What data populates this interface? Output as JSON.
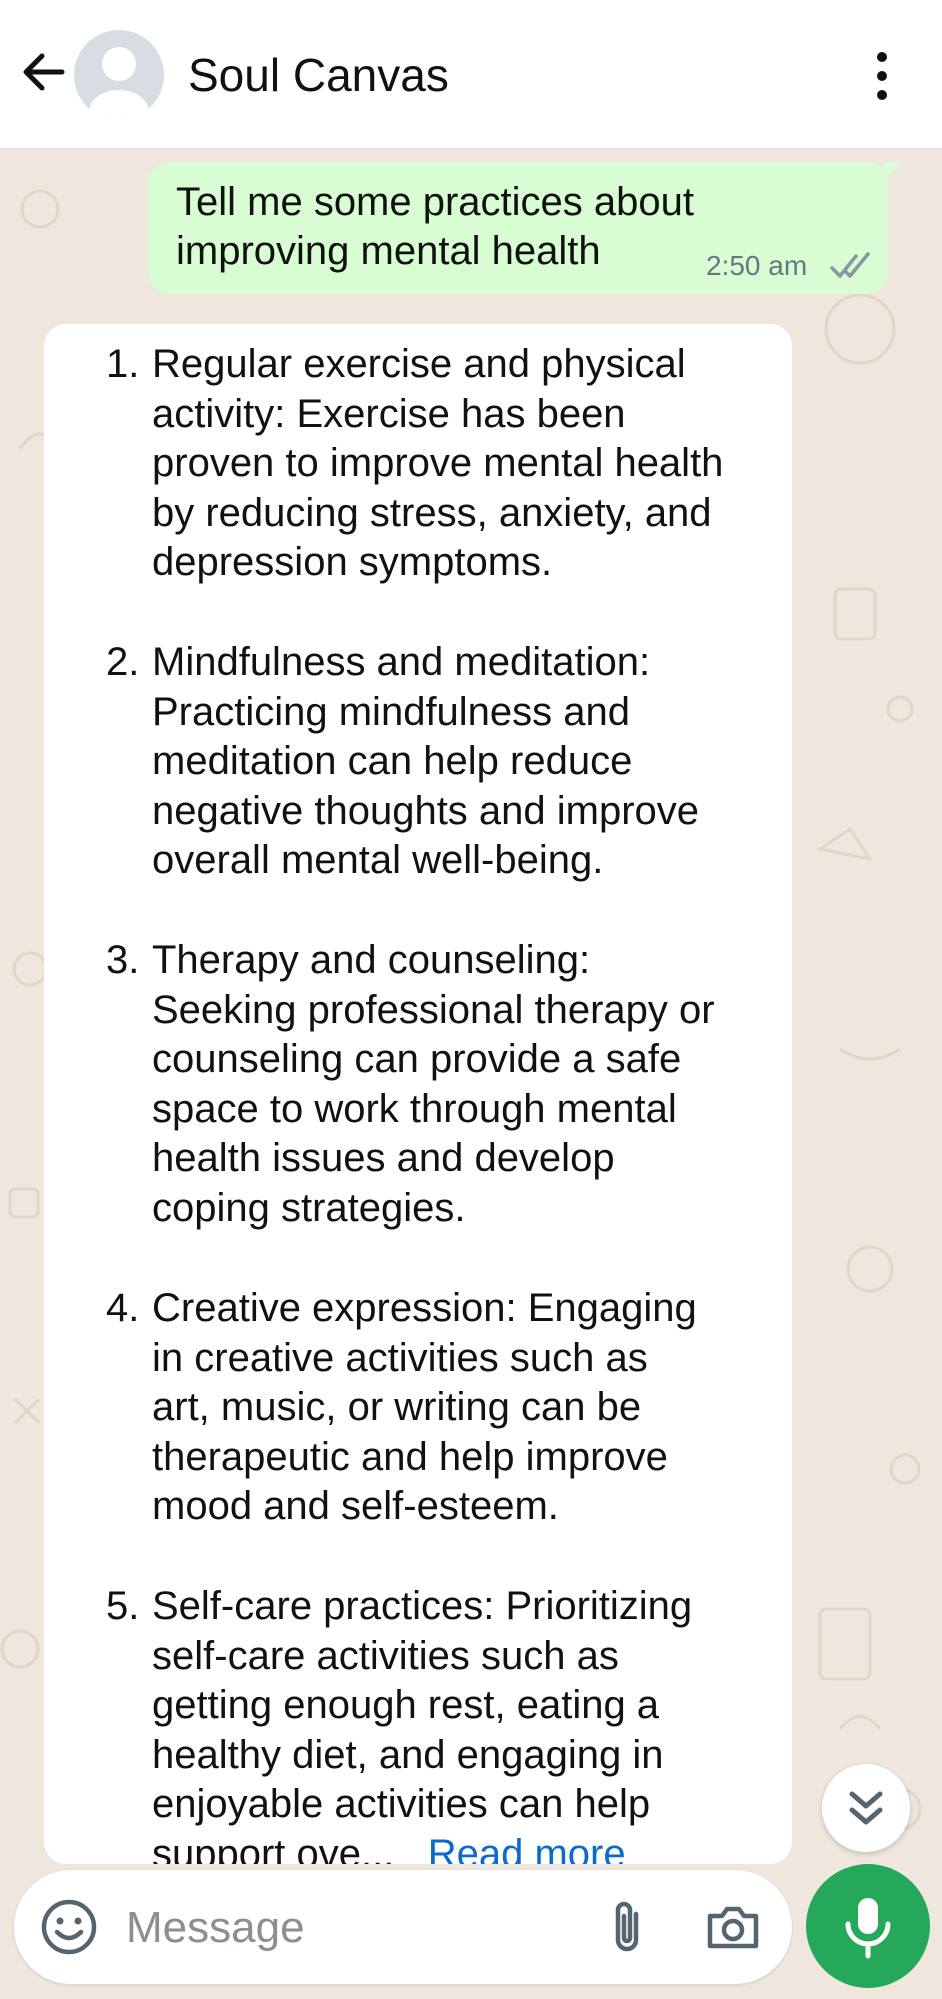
{
  "header": {
    "contact_name": "Soul Canvas",
    "back_icon": "arrow-left-icon",
    "menu_icon": "more-vertical-icon"
  },
  "messages": {
    "outgoing": {
      "text_line1": "Tell me some practices about",
      "text_line2": "improving mental health",
      "time": "2:50 am",
      "status_icon": "double-check-icon"
    },
    "incoming": {
      "items": [
        {
          "number": "1.",
          "lines": [
            "Regular exercise and physical",
            "activity: Exercise has been",
            "proven to improve mental health",
            "by reducing stress, anxiety, and",
            "depression symptoms."
          ]
        },
        {
          "number": "2.",
          "lines": [
            "Mindfulness and meditation:",
            "Practicing mindfulness and",
            "meditation can help reduce",
            "negative thoughts and improve",
            "overall mental well-being."
          ]
        },
        {
          "number": "3.",
          "lines": [
            "Therapy and counseling:",
            "Seeking professional therapy or",
            "counseling can provide a safe",
            "space to work through mental",
            "health issues and develop",
            "coping strategies."
          ]
        },
        {
          "number": "4.",
          "lines": [
            "Creative expression: Engaging",
            "in creative activities such as",
            "art, music, or writing can be",
            "therapeutic and help improve",
            "mood and self-esteem."
          ]
        },
        {
          "number": "5.",
          "lines": [
            "Self-care practices: Prioritizing",
            "self-care activities such as",
            "getting enough rest, eating a",
            "healthy diet, and engaging in",
            "enjoyable activities can help",
            "support ove..."
          ]
        }
      ],
      "read_more": "Read more"
    }
  },
  "composer": {
    "placeholder": "Message",
    "emoji_icon": "emoji-icon",
    "attach_icon": "paperclip-icon",
    "camera_icon": "camera-icon",
    "mic_icon": "microphone-icon"
  },
  "scroll_down_icon": "double-chevron-down-icon",
  "colors": {
    "outgoing_bubble": "#d9fdd3",
    "incoming_bubble": "#ffffff",
    "accent_green": "#25a85a",
    "link": "#0b6bcb",
    "wallpaper": "#efe7dd"
  }
}
